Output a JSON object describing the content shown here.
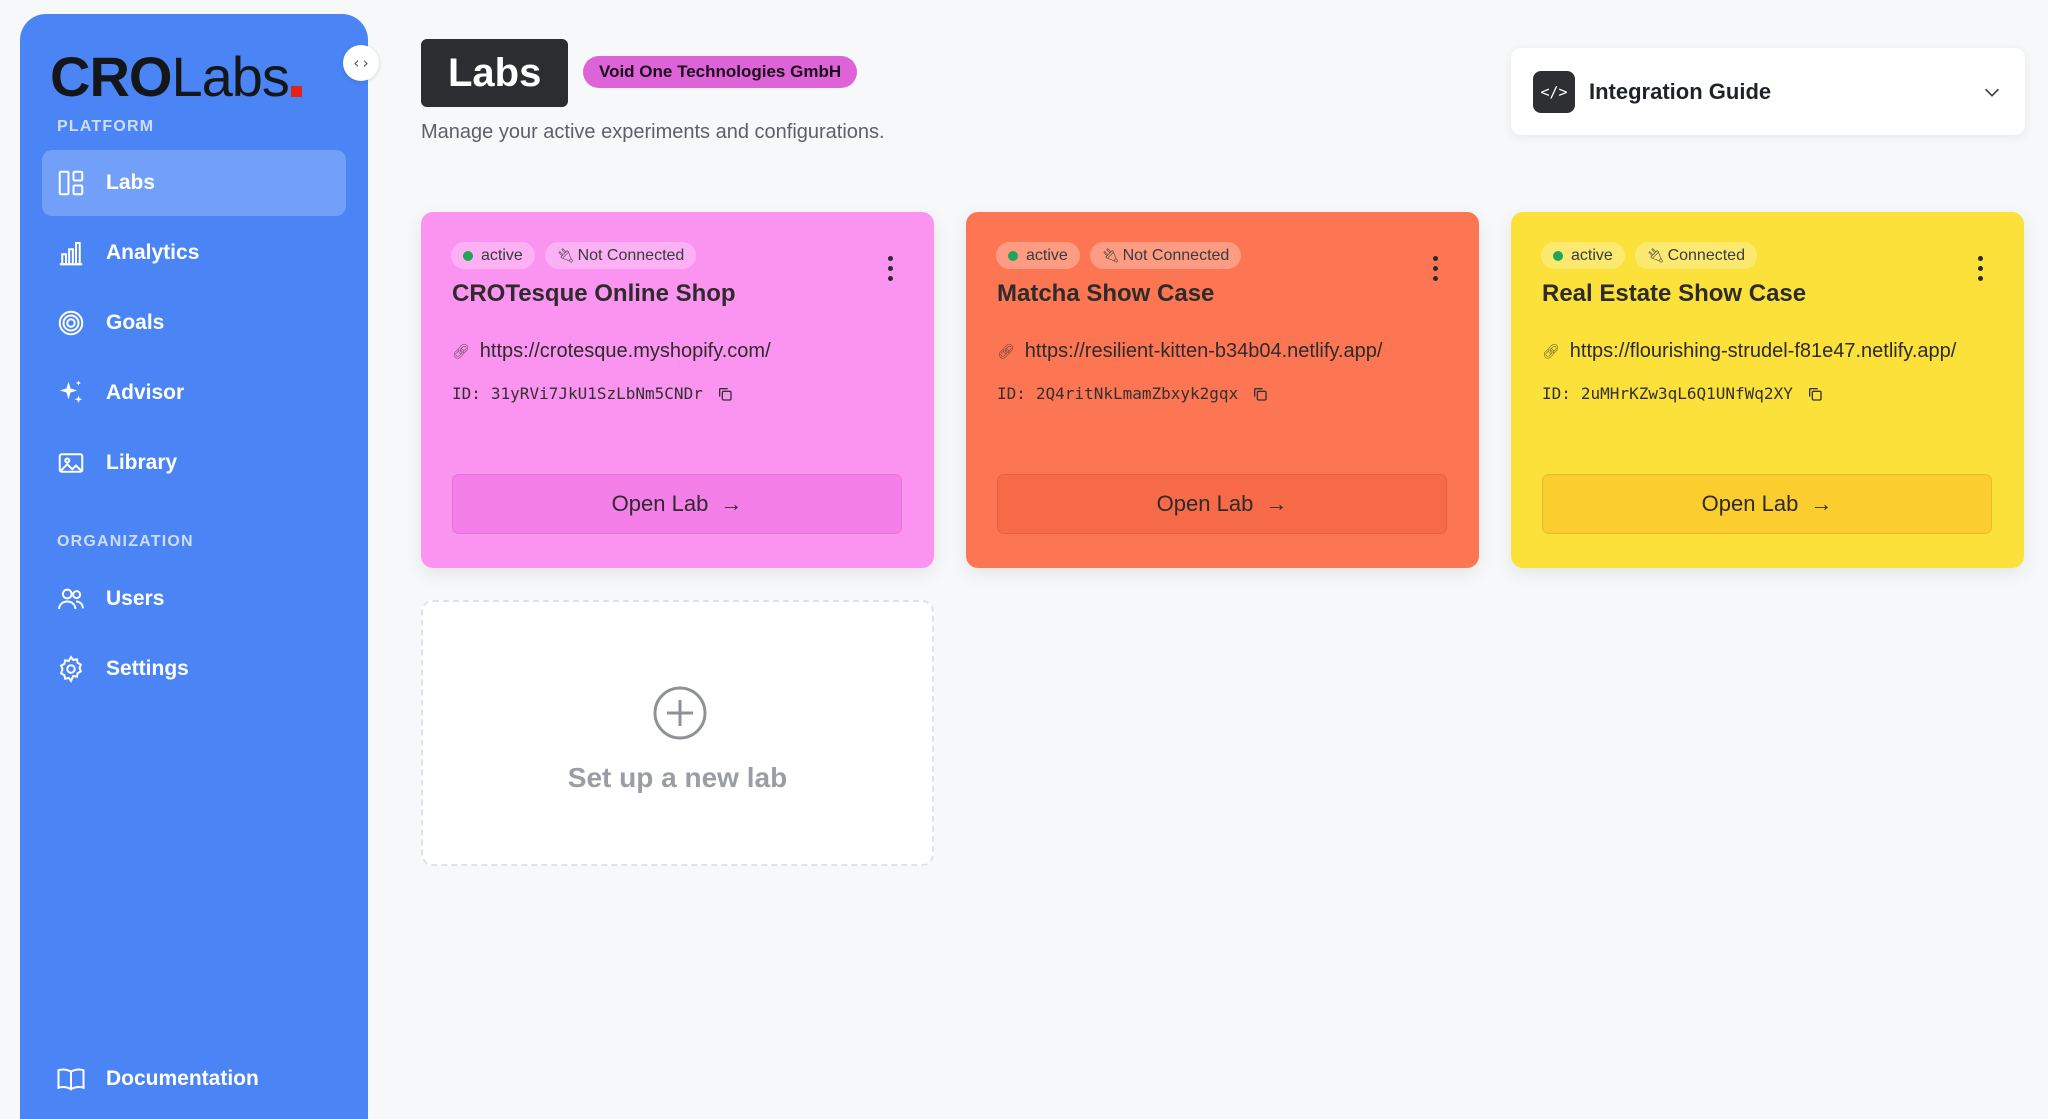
{
  "brand": {
    "name_bold": "CRO",
    "name_light": "Labs",
    "accent": "#e2231a"
  },
  "sidebar": {
    "bg": "#4b85f5",
    "sections": {
      "platform": "PLATFORM",
      "organization": "ORGANIZATION"
    },
    "items": [
      {
        "label": "Labs",
        "icon": "layout-icon",
        "active": true
      },
      {
        "label": "Analytics",
        "icon": "bar-chart-icon",
        "active": false
      },
      {
        "label": "Goals",
        "icon": "target-icon",
        "active": false
      },
      {
        "label": "Advisor",
        "icon": "sparkles-icon",
        "active": false
      },
      {
        "label": "Library",
        "icon": "image-icon",
        "active": false
      },
      {
        "label": "Users",
        "icon": "users-icon",
        "active": false
      },
      {
        "label": "Settings",
        "icon": "gear-icon",
        "active": false
      }
    ],
    "footer": {
      "label": "Documentation",
      "icon": "book-icon"
    }
  },
  "header": {
    "title": "Labs",
    "org_badge": "Void One Technologies GmbH",
    "subtitle": "Manage your active experiments and configurations.",
    "guide_label": "Integration Guide"
  },
  "labs": [
    {
      "status": "active",
      "connection": "Not Connected",
      "name": "CROTesque Online Shop",
      "url": "https://crotesque.myshopify.com/",
      "id_label": "ID:",
      "id": "31yRVi7JkU1SzLbNm5CNDr",
      "button": "Open Lab",
      "color": "#fb94f1",
      "button_color": "#f57fe8"
    },
    {
      "status": "active",
      "connection": "Not Connected",
      "name": "Matcha Show Case",
      "url": "https://resilient-kitten-b34b04.netlify.app/",
      "id_label": "ID:",
      "id": "2Q4ritNkLmamZbxyk2gqx",
      "button": "Open Lab",
      "color": "#fd7654",
      "button_color": "#f76a47"
    },
    {
      "status": "active",
      "connection": "Connected",
      "name": "Real Estate Show Case",
      "url": "https://flourishing-strudel-f81e47.netlify.app/",
      "id_label": "ID:",
      "id": "2uMHrKZw3qL6Q1UNfWq2XY",
      "button": "Open Lab",
      "color": "#fbe13a",
      "button_color": "#fbcd2e"
    }
  ],
  "new_lab": {
    "label": "Set up a new lab",
    "icon": "plus-circle-icon"
  }
}
